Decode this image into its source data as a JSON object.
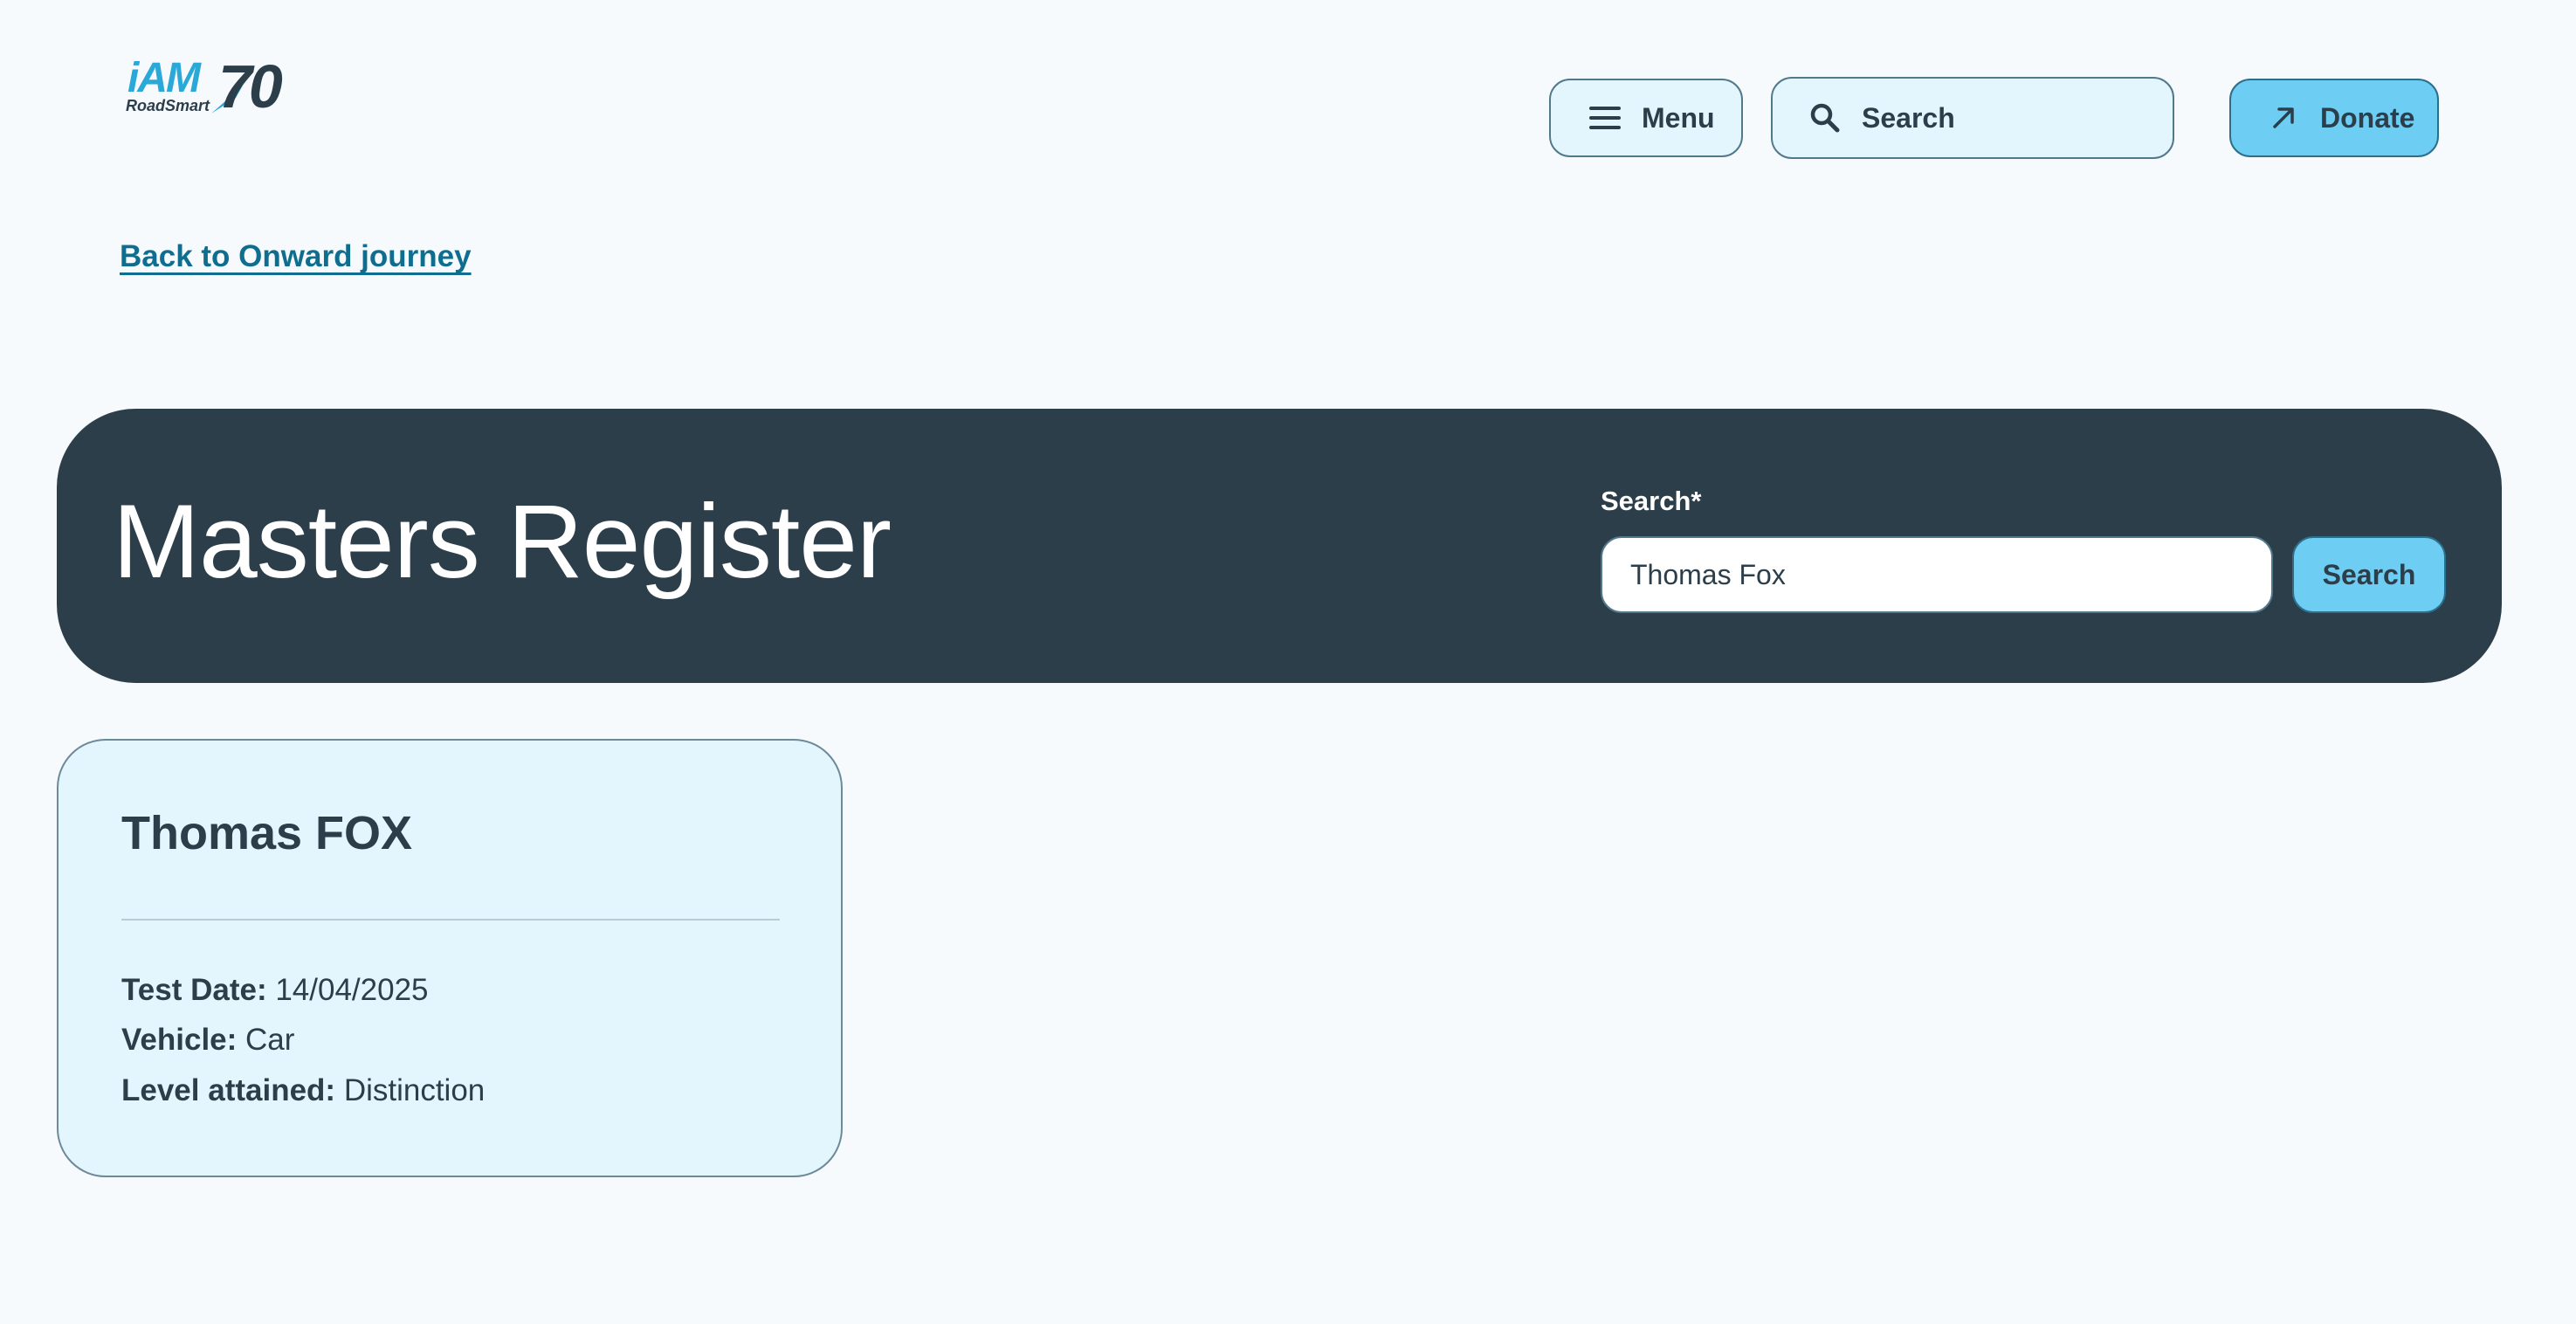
{
  "header": {
    "logo": {
      "brand": "iAM",
      "sub": "RoadSmart",
      "anniversary": "70"
    },
    "menu_button": {
      "label": "Menu",
      "icon": "hamburger-icon"
    },
    "search_button": {
      "label": "Search",
      "icon": "search-icon"
    },
    "donate_button": {
      "label": "Donate",
      "icon": "arrow-up-right-icon"
    }
  },
  "back_link": {
    "label": "Back to Onward journey"
  },
  "hero": {
    "title": "Masters Register",
    "search": {
      "label": "Search*",
      "value": "Thomas Fox",
      "button_label": "Search"
    }
  },
  "results": [
    {
      "name": "Thomas FOX",
      "fields": [
        {
          "label": "Test Date:",
          "value": "14/04/2025"
        },
        {
          "label": "Vehicle:",
          "value": "Car"
        },
        {
          "label": "Level attained:",
          "value": "Distinction"
        }
      ]
    }
  ],
  "colors": {
    "background": "#f6fafd",
    "navy": "#2d3e4b",
    "light_blue": "#e4f6fd",
    "accent": "#6dcdf2",
    "link": "#0f6e8f",
    "logo_blue": "#2aa8d8"
  }
}
